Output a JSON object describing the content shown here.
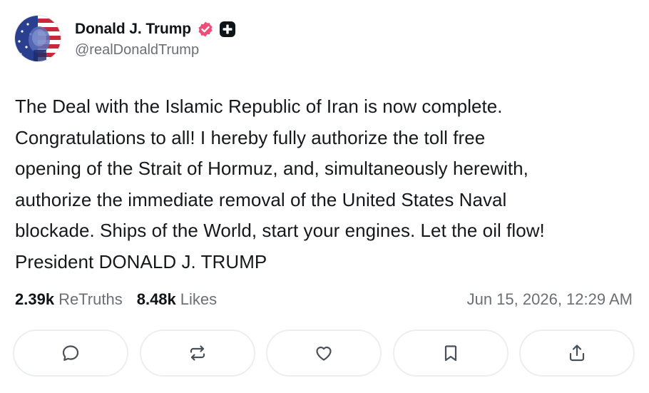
{
  "author": {
    "display_name": "Donald J. Trump",
    "handle": "@realDonaldTrump",
    "avatar_icon": "avatar-flag-portrait",
    "verified_icon": "verified-badge-icon",
    "plus_icon": "plus-badge-icon",
    "verified_color": "#ef4d78"
  },
  "post": {
    "lines": [
      "The Deal with the Islamic Republic of Iran is now complete.",
      "Congratulations to all! I hereby fully authorize the toll free",
      "opening of the Strait of Hormuz, and, simultaneously herewith,",
      "authorize the immediate removal of the United States Naval",
      "blockade. Ships of the World, start your engines. Let the oil flow!",
      "President DONALD J. TRUMP"
    ]
  },
  "stats": {
    "retruths_count": "2.39k",
    "retruths_label": "ReTruths",
    "likes_count": "8.48k",
    "likes_label": "Likes",
    "timestamp": "Jun 15, 2026, 12:29 AM"
  },
  "actions": [
    {
      "icon": "reply-icon"
    },
    {
      "icon": "retruth-icon"
    },
    {
      "icon": "like-icon"
    },
    {
      "icon": "bookmark-icon"
    },
    {
      "icon": "share-icon"
    }
  ]
}
